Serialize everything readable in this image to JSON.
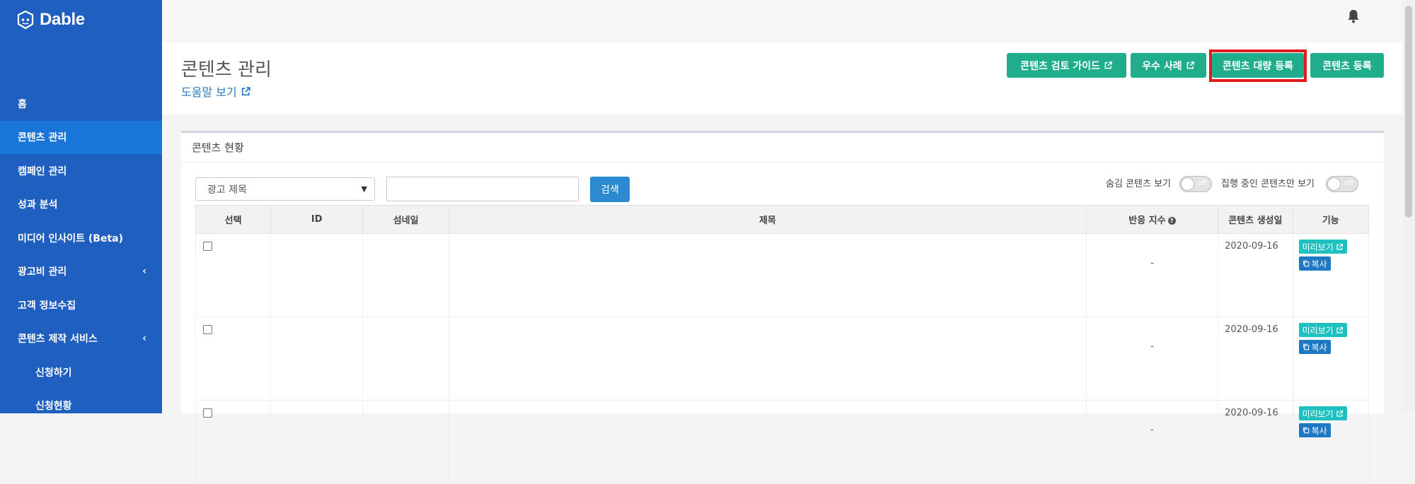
{
  "app": {
    "name": "Dable"
  },
  "sidebar": {
    "items": [
      {
        "label": "홈"
      },
      {
        "label": "콘텐츠 관리",
        "active": true
      },
      {
        "label": "캠페인 관리"
      },
      {
        "label": "성과 분석"
      },
      {
        "label": "미디어 인사이트 (Beta)"
      },
      {
        "label": "광고비 관리",
        "chevron": "chevron-left-icon"
      },
      {
        "label": "고객 정보수집"
      },
      {
        "label": "콘텐츠 제작 서비스",
        "chevron": "chevron-left-icon"
      },
      {
        "label": "신청하기",
        "sub": true
      },
      {
        "label": "신청현황",
        "sub": true
      }
    ]
  },
  "header": {
    "title": "콘텐츠 관리",
    "help_link": "도움말 보기",
    "buttons": {
      "review_guide": "콘텐츠 검토 가이드",
      "best_cases": "우수 사례",
      "bulk_register": "콘텐츠 대량 등록",
      "register": "콘텐츠 등록"
    }
  },
  "card": {
    "title": "콘텐츠 현황",
    "filter": {
      "select_value": "광고 제목",
      "search_value": "",
      "search_label": "검색"
    },
    "toggles": {
      "hidden_label": "숨김 콘텐츠 보기",
      "running_label": "집행 중인 콘텐츠만 보기",
      "state_text": "off"
    },
    "table": {
      "columns": [
        "선택",
        "ID",
        "섬네일",
        "제목",
        "반응 지수",
        "콘텐츠 생성일",
        "기능"
      ],
      "rows": [
        {
          "id": "",
          "thumbnail": "",
          "title": "",
          "response": "-",
          "created": "2020-09-16",
          "preview": "미리보기",
          "copy": "복사"
        },
        {
          "id": "",
          "thumbnail": "",
          "title": "",
          "response": "-",
          "created": "2020-09-16",
          "preview": "미리보기",
          "copy": "복사"
        },
        {
          "id": "",
          "thumbnail": "",
          "title": "",
          "response": "-",
          "created": "2020-09-16",
          "preview": "미리보기",
          "copy": "복사"
        }
      ]
    }
  },
  "colors": {
    "sidebar": "#1f5fbf",
    "sidebar_active": "#1976d8",
    "green_button": "#1fad8c",
    "search_button": "#2b8ad0",
    "preview_button": "#1fc0c0",
    "copy_button": "#1f78c4",
    "highlight_border": "#e01b1b"
  }
}
